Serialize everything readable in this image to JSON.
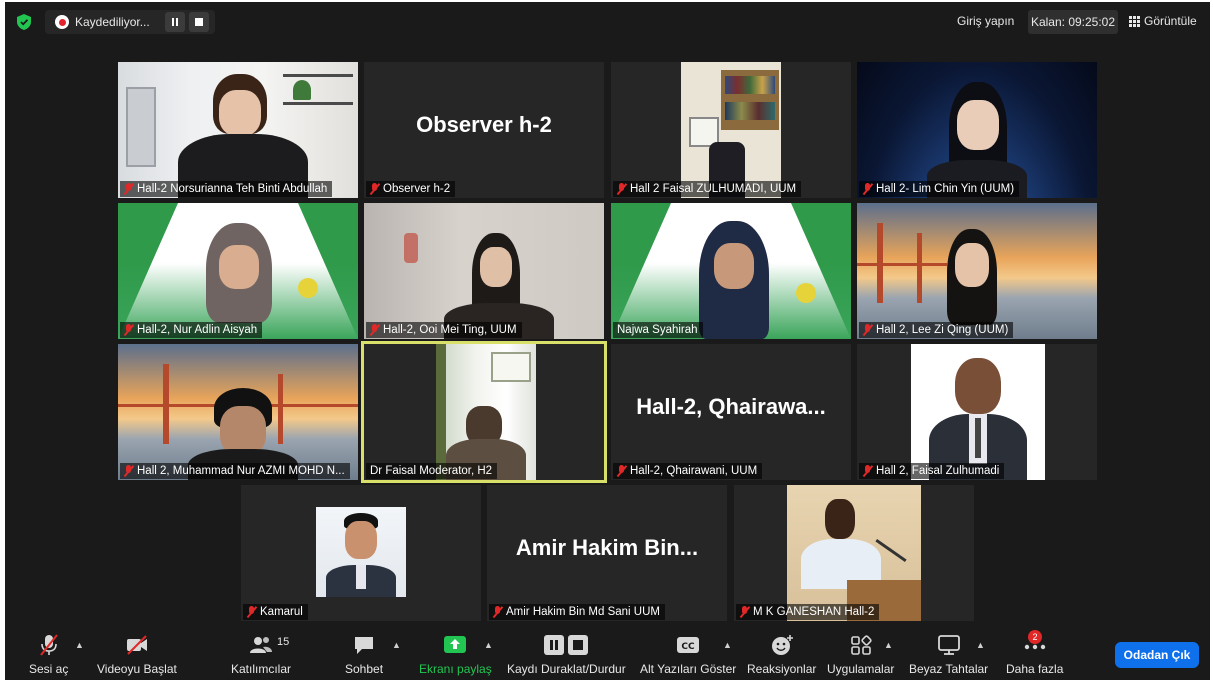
{
  "topbar": {
    "recording_label": "Kaydediliyor...",
    "signin_label": "Giriş yapın",
    "timer_label": "Kalan: 09:25:02",
    "view_label": "Görüntüle"
  },
  "participants": [
    {
      "label": "Hall-2 Norsurianna Teh Binti Abdullah"
    },
    {
      "label": "Observer h-2",
      "display_name": "Observer h-2"
    },
    {
      "label": "Hall 2 Faisal ZULHUMADI, UUM"
    },
    {
      "label": "Hall 2- Lim Chin Yin (UUM)"
    },
    {
      "label": "Hall-2, Nur Adlin Aisyah"
    },
    {
      "label": "Hall-2, Ooi Mei Ting, UUM"
    },
    {
      "label": "Najwa Syahirah"
    },
    {
      "label": "Hall 2, Lee Zi Qing (UUM)"
    },
    {
      "label": "Hall 2, Muhammad Nur AZMI MOHD N..."
    },
    {
      "label": "Dr Faisal Moderator, H2"
    },
    {
      "label": "Hall-2, Qhairawani, UUM",
      "display_name": "Hall-2,  Qhairawa..."
    },
    {
      "label": "Hall 2, Faisal Zulhumadi"
    },
    {
      "label": "Kamarul"
    },
    {
      "label": "Amir Hakim Bin Md Sani UUM",
      "display_name": "Amir  Hakim  Bin..."
    },
    {
      "label": "M K GANESHAN Hall-2"
    }
  ],
  "toolbar": {
    "unmute_label": "Sesi aç",
    "video_label": "Videoyu Başlat",
    "participants_label": "Katılımcılar",
    "participants_count": "15",
    "chat_label": "Sohbet",
    "share_label": "Ekranı paylaş",
    "record_label": "Kaydı Duraklat/Durdur",
    "captions_label": "Alt Yazıları Göster",
    "reactions_label": "Reaksiyonlar",
    "apps_label": "Uygulamalar",
    "whiteboard_label": "Beyaz Tahtalar",
    "more_label": "Daha fazla",
    "more_badge": "2",
    "leave_label": "Odadan Çık"
  },
  "colors": {
    "background": "#1a1a1a",
    "tile": "#262626",
    "active_speaker": "#d8e06a",
    "share_green": "#23c552",
    "leave_blue": "#0e71eb",
    "muted_red": "#e02828"
  }
}
